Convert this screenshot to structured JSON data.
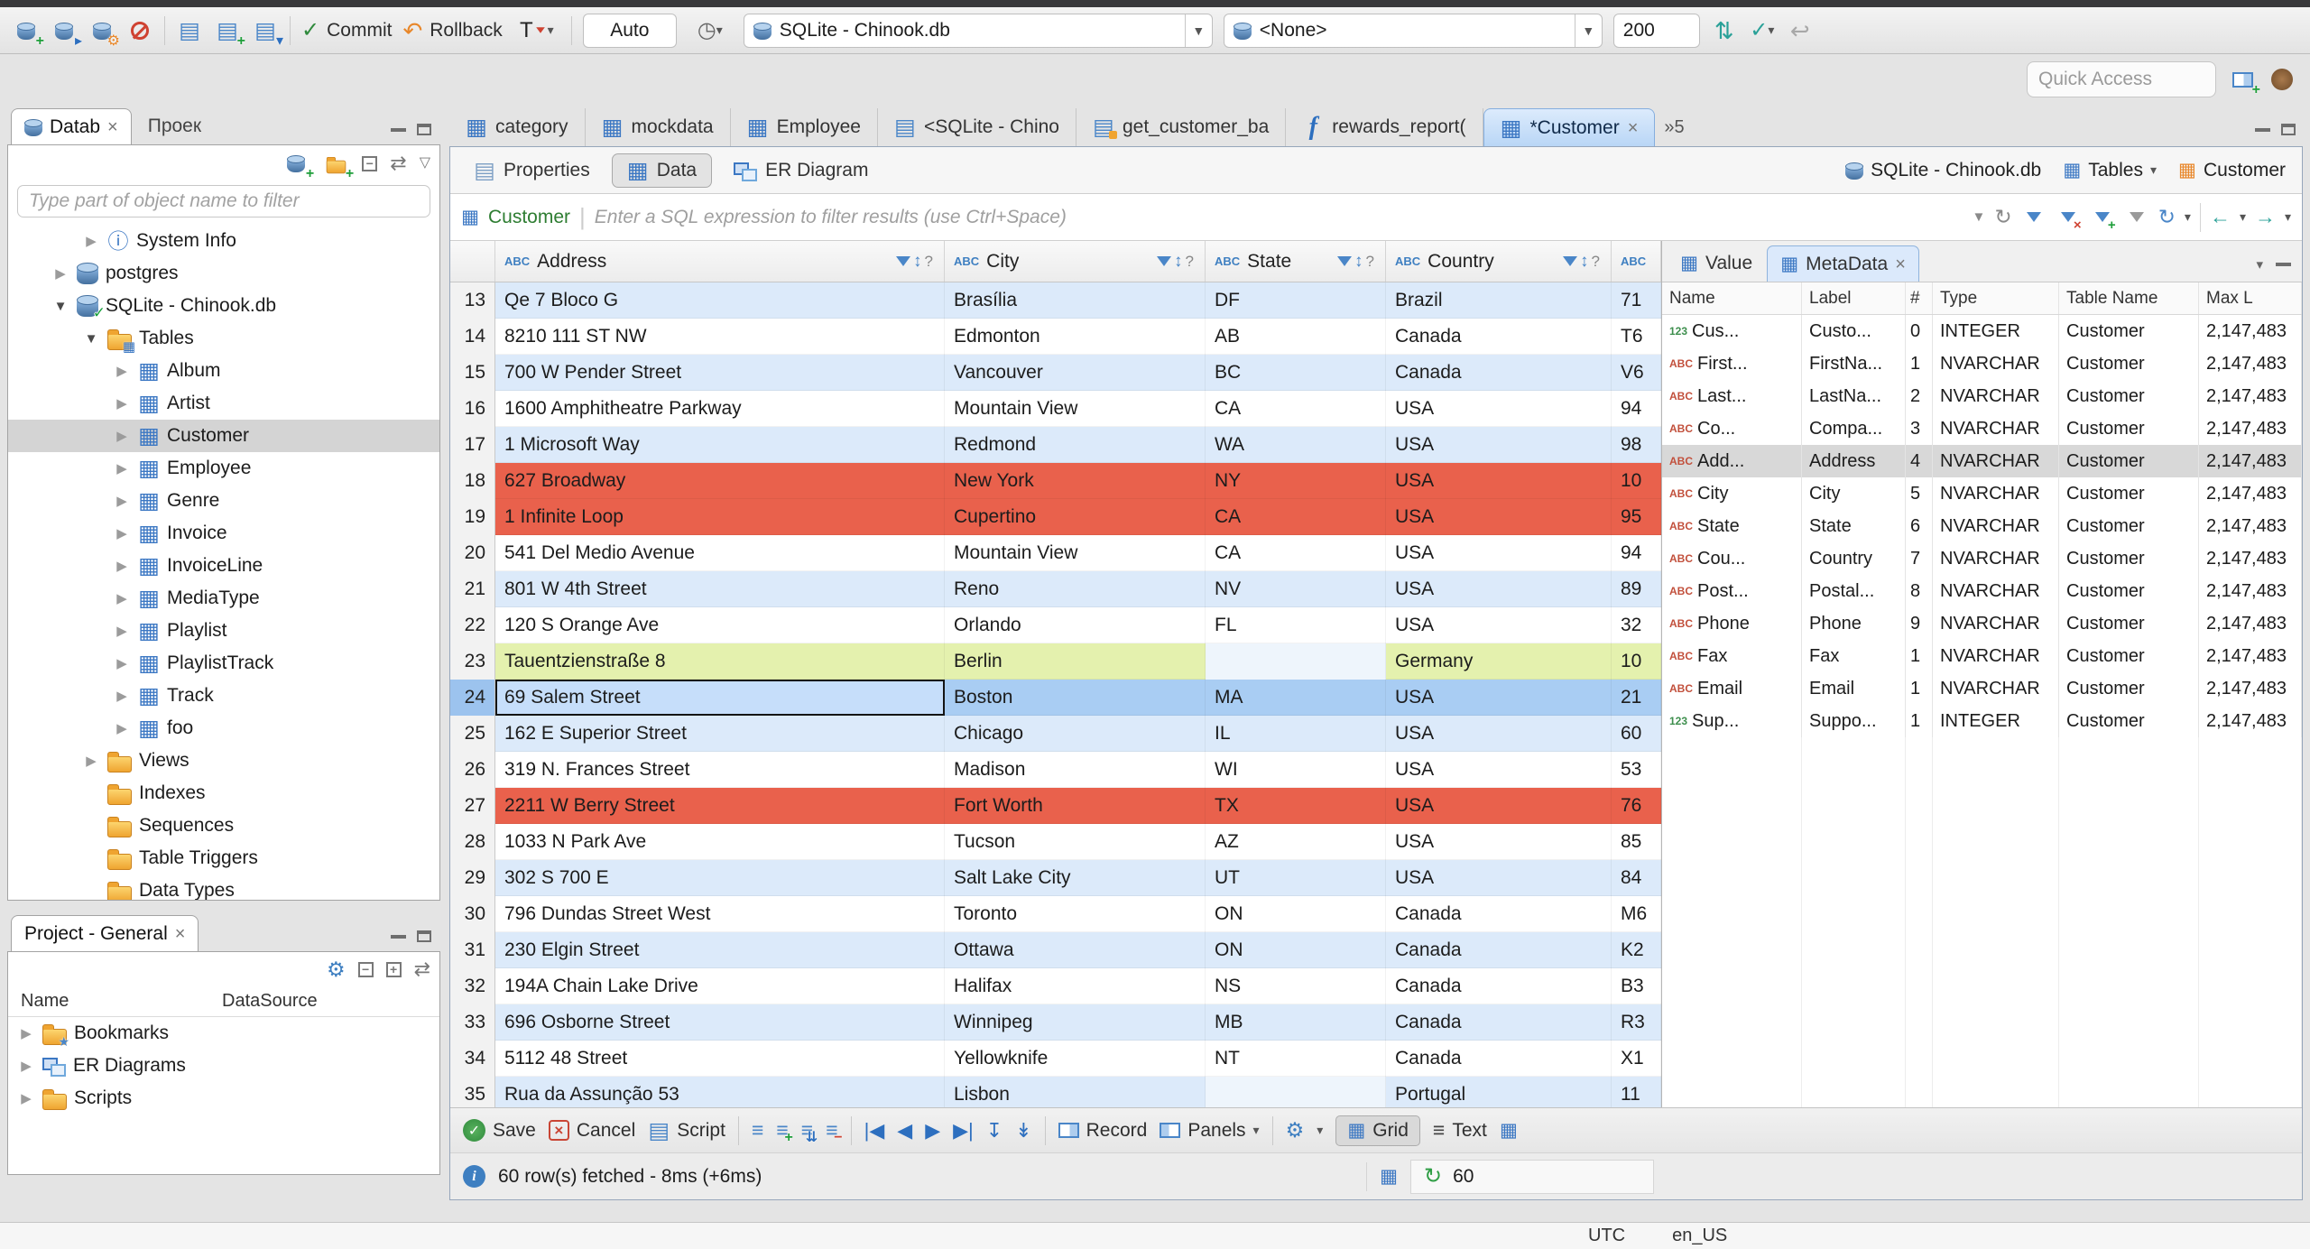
{
  "top_toolbar": {
    "commit": "Commit",
    "rollback": "Rollback",
    "auto": "Auto",
    "connection": "SQLite - Chinook.db",
    "schema": "<None>",
    "fetch_size": "200",
    "quick_access_placeholder": "Quick Access"
  },
  "navigator": {
    "tab_database": "Datab",
    "tab_projects": "Проек",
    "filter_placeholder": "Type part of object name to filter",
    "tree": [
      {
        "label": "System Info",
        "icon": "icon-info",
        "arrow": "arrow-right",
        "indent": 2,
        "row_class": ""
      },
      {
        "label": "postgres",
        "icon": "icon-db",
        "arrow": "arrow-right",
        "indent": 1,
        "row_class": ""
      },
      {
        "label": "SQLite - Chinook.db",
        "icon": "icon-db-on",
        "arrow": "arrow-down",
        "indent": 1,
        "row_class": ""
      },
      {
        "label": "Tables",
        "icon": "icon-folder icon-folder-table",
        "arrow": "arrow-down",
        "indent": 2,
        "row_class": ""
      },
      {
        "label": "Album",
        "icon": "icon-table",
        "arrow": "arrow-right",
        "indent": 3,
        "row_class": ""
      },
      {
        "label": "Artist",
        "icon": "icon-table",
        "arrow": "arrow-right",
        "indent": 3,
        "row_class": ""
      },
      {
        "label": "Customer",
        "icon": "icon-table",
        "arrow": "arrow-right",
        "indent": 3,
        "row_class": "selected"
      },
      {
        "label": "Employee",
        "icon": "icon-table",
        "arrow": "arrow-right",
        "indent": 3,
        "row_class": ""
      },
      {
        "label": "Genre",
        "icon": "icon-table",
        "arrow": "arrow-right",
        "indent": 3,
        "row_class": ""
      },
      {
        "label": "Invoice",
        "icon": "icon-table",
        "arrow": "arrow-right",
        "indent": 3,
        "row_class": ""
      },
      {
        "label": "InvoiceLine",
        "icon": "icon-table",
        "arrow": "arrow-right",
        "indent": 3,
        "row_class": ""
      },
      {
        "label": "MediaType",
        "icon": "icon-table",
        "arrow": "arrow-right",
        "indent": 3,
        "row_class": ""
      },
      {
        "label": "Playlist",
        "icon": "icon-table",
        "arrow": "arrow-right",
        "indent": 3,
        "row_class": ""
      },
      {
        "label": "PlaylistTrack",
        "icon": "icon-table",
        "arrow": "arrow-right",
        "indent": 3,
        "row_class": ""
      },
      {
        "label": "Track",
        "icon": "icon-table",
        "arrow": "arrow-right",
        "indent": 3,
        "row_class": ""
      },
      {
        "label": "foo",
        "icon": "icon-table",
        "arrow": "arrow-right",
        "indent": 3,
        "row_class": ""
      },
      {
        "label": "Views",
        "icon": "icon-folder",
        "arrow": "arrow-right",
        "indent": 2,
        "row_class": ""
      },
      {
        "label": "Indexes",
        "icon": "icon-folder",
        "arrow": "arrow-none",
        "indent": 2,
        "row_class": ""
      },
      {
        "label": "Sequences",
        "icon": "icon-folder",
        "arrow": "arrow-none",
        "indent": 2,
        "row_class": ""
      },
      {
        "label": "Table Triggers",
        "icon": "icon-folder",
        "arrow": "arrow-none",
        "indent": 2,
        "row_class": ""
      },
      {
        "label": "Data Types",
        "icon": "icon-folder",
        "arrow": "arrow-none",
        "indent": 2,
        "row_class": ""
      }
    ]
  },
  "project_panel": {
    "title": "Project - General",
    "col_name": "Name",
    "col_datasource": "DataSource",
    "tree": [
      {
        "label": "Bookmarks",
        "icon": "icon-folder icon-folder-star",
        "arrow": "arrow-right"
      },
      {
        "label": "ER Diagrams",
        "icon": "icon-er",
        "arrow": "arrow-right"
      },
      {
        "label": "Scripts",
        "icon": "icon-folder",
        "arrow": "arrow-right"
      }
    ]
  },
  "editor": {
    "tabs": [
      {
        "label": "category",
        "icon": "icon-table",
        "tab_class": "",
        "close_class": "hide"
      },
      {
        "label": "mockdata",
        "icon": "icon-table",
        "tab_class": "",
        "close_class": "hide"
      },
      {
        "label": "Employee",
        "icon": "icon-table",
        "tab_class": "",
        "close_class": "hide"
      },
      {
        "label": "<SQLite - Chino",
        "icon": "icon-sql",
        "tab_class": "",
        "close_class": "hide"
      },
      {
        "label": "get_customer_ba",
        "icon": "icon-sql icon-sql-edit",
        "tab_class": "",
        "close_class": "hide"
      },
      {
        "label": "rewards_report(",
        "icon": "icon-func",
        "tab_class": "",
        "close_class": "hide"
      },
      {
        "label": "*Customer",
        "icon": "icon-table",
        "tab_class": "tab-active",
        "close_class": "show"
      },
      {
        "label": "»5",
        "icon": "icon-none",
        "tab_class": "tab-overflow",
        "close_class": "hide"
      }
    ],
    "result_tabs": {
      "properties": "Properties",
      "data": "Data",
      "er_diagram": "ER Diagram"
    },
    "context": {
      "connection": "SQLite - Chinook.db",
      "container": "Tables",
      "entity": "Customer"
    },
    "filter": {
      "table": "Customer",
      "placeholder": "Enter a SQL expression to filter results (use Ctrl+Space)"
    }
  },
  "grid": {
    "columns": [
      "Address",
      "City",
      "State",
      "Country"
    ],
    "rows": [
      {
        "num": "13",
        "address": "Qe 7 Bloco G",
        "city": "Brasília",
        "state": "DF",
        "country": "Brazil",
        "postal": "71",
        "row_class": "r-alt",
        "addr_class": "",
        "state_class": ""
      },
      {
        "num": "14",
        "address": "8210 111 ST NW",
        "city": "Edmonton",
        "state": "AB",
        "country": "Canada",
        "postal": "T6",
        "row_class": "",
        "addr_class": "",
        "state_class": ""
      },
      {
        "num": "15",
        "address": "700 W Pender Street",
        "city": "Vancouver",
        "state": "BC",
        "country": "Canada",
        "postal": "V6",
        "row_class": "r-alt",
        "addr_class": "",
        "state_class": ""
      },
      {
        "num": "16",
        "address": "1600 Amphitheatre Parkway",
        "city": "Mountain View",
        "state": "CA",
        "country": "USA",
        "postal": "94",
        "row_class": "",
        "addr_class": "",
        "state_class": ""
      },
      {
        "num": "17",
        "address": "1 Microsoft Way",
        "city": "Redmond",
        "state": "WA",
        "country": "USA",
        "postal": "98",
        "row_class": "r-alt",
        "addr_class": "",
        "state_class": ""
      },
      {
        "num": "18",
        "address": "627 Broadway",
        "city": "New York",
        "state": "NY",
        "country": "USA",
        "postal": "10",
        "row_class": "r-red",
        "addr_class": "",
        "state_class": ""
      },
      {
        "num": "19",
        "address": "1 Infinite Loop",
        "city": "Cupertino",
        "state": "CA",
        "country": "USA",
        "postal": "95",
        "row_class": "r-red",
        "addr_class": "",
        "state_class": ""
      },
      {
        "num": "20",
        "address": "541 Del Medio Avenue",
        "city": "Mountain View",
        "state": "CA",
        "country": "USA",
        "postal": "94",
        "row_class": "",
        "addr_class": "",
        "state_class": ""
      },
      {
        "num": "21",
        "address": "801 W 4th Street",
        "city": "Reno",
        "state": "NV",
        "country": "USA",
        "postal": "89",
        "row_class": "r-alt",
        "addr_class": "",
        "state_class": ""
      },
      {
        "num": "22",
        "address": "120 S Orange Ave",
        "city": "Orlando",
        "state": "FL",
        "country": "USA",
        "postal": "32",
        "row_class": "",
        "addr_class": "",
        "state_class": ""
      },
      {
        "num": "23",
        "address": "Tauentzienstraße 8",
        "city": "Berlin",
        "state": "",
        "country": "Germany",
        "postal": "10",
        "row_class": "r-green",
        "addr_class": "",
        "state_class": "null-cell"
      },
      {
        "num": "24",
        "address": "69 Salem Street",
        "city": "Boston",
        "state": "MA",
        "country": "USA",
        "postal": "21",
        "row_class": "r-sel",
        "addr_class": "focus-cell",
        "state_class": ""
      },
      {
        "num": "25",
        "address": "162 E Superior Street",
        "city": "Chicago",
        "state": "IL",
        "country": "USA",
        "postal": "60",
        "row_class": "r-alt",
        "addr_class": "",
        "state_class": ""
      },
      {
        "num": "26",
        "address": "319 N. Frances Street",
        "city": "Madison",
        "state": "WI",
        "country": "USA",
        "postal": "53",
        "row_class": "",
        "addr_class": "",
        "state_class": ""
      },
      {
        "num": "27",
        "address": "2211 W Berry Street",
        "city": "Fort Worth",
        "state": "TX",
        "country": "USA",
        "postal": "76",
        "row_class": "r-red",
        "addr_class": "",
        "state_class": ""
      },
      {
        "num": "28",
        "address": "1033 N Park Ave",
        "city": "Tucson",
        "state": "AZ",
        "country": "USA",
        "postal": "85",
        "row_class": "",
        "addr_class": "",
        "state_class": ""
      },
      {
        "num": "29",
        "address": "302 S 700 E",
        "city": "Salt Lake City",
        "state": "UT",
        "country": "USA",
        "postal": "84",
        "row_class": "r-alt",
        "addr_class": "",
        "state_class": ""
      },
      {
        "num": "30",
        "address": "796 Dundas Street West",
        "city": "Toronto",
        "state": "ON",
        "country": "Canada",
        "postal": "M6",
        "row_class": "",
        "addr_class": "",
        "state_class": ""
      },
      {
        "num": "31",
        "address": "230 Elgin Street",
        "city": "Ottawa",
        "state": "ON",
        "country": "Canada",
        "postal": "K2",
        "row_class": "r-alt",
        "addr_class": "",
        "state_class": ""
      },
      {
        "num": "32",
        "address": "194A Chain Lake Drive",
        "city": "Halifax",
        "state": "NS",
        "country": "Canada",
        "postal": "B3",
        "row_class": "",
        "addr_class": "",
        "state_class": ""
      },
      {
        "num": "33",
        "address": "696 Osborne Street",
        "city": "Winnipeg",
        "state": "MB",
        "country": "Canada",
        "postal": "R3",
        "row_class": "r-alt",
        "addr_class": "",
        "state_class": ""
      },
      {
        "num": "34",
        "address": "5112 48 Street",
        "city": "Yellowknife",
        "state": "NT",
        "country": "Canada",
        "postal": "X1",
        "row_class": "",
        "addr_class": "",
        "state_class": ""
      },
      {
        "num": "35",
        "address": "Rua da Assunção 53",
        "city": "Lisbon",
        "state": "",
        "country": "Portugal",
        "postal": "11",
        "row_class": "r-alt",
        "addr_class": "",
        "state_class": "null-cell"
      }
    ]
  },
  "metadata": {
    "tab_value": "Value",
    "tab_metadata": "MetaData",
    "columns": [
      "Name",
      "Label",
      "#",
      "Type",
      "Table Name",
      "Max L"
    ],
    "rows": [
      {
        "dt": "dt-num",
        "name": "Cus...",
        "label": "Custo...",
        "num": "0",
        "type": "INTEGER",
        "table": "Customer",
        "max": "2,147,483",
        "row_class": ""
      },
      {
        "dt": "dt-text",
        "name": "First...",
        "label": "FirstNa...",
        "num": "1",
        "type": "NVARCHAR",
        "table": "Customer",
        "max": "2,147,483",
        "row_class": ""
      },
      {
        "dt": "dt-text",
        "name": "Last...",
        "label": "LastNa...",
        "num": "2",
        "type": "NVARCHAR",
        "table": "Customer",
        "max": "2,147,483",
        "row_class": ""
      },
      {
        "dt": "dt-text",
        "name": "Co...",
        "label": "Compa...",
        "num": "3",
        "type": "NVARCHAR",
        "table": "Customer",
        "max": "2,147,483",
        "row_class": ""
      },
      {
        "dt": "dt-text",
        "name": "Add...",
        "label": "Address",
        "num": "4",
        "type": "NVARCHAR",
        "table": "Customer",
        "max": "2,147,483",
        "row_class": "m-sel"
      },
      {
        "dt": "dt-text",
        "name": "City",
        "label": "City",
        "num": "5",
        "type": "NVARCHAR",
        "table": "Customer",
        "max": "2,147,483",
        "row_class": ""
      },
      {
        "dt": "dt-text",
        "name": "State",
        "label": "State",
        "num": "6",
        "type": "NVARCHAR",
        "table": "Customer",
        "max": "2,147,483",
        "row_class": ""
      },
      {
        "dt": "dt-text",
        "name": "Cou...",
        "label": "Country",
        "num": "7",
        "type": "NVARCHAR",
        "table": "Customer",
        "max": "2,147,483",
        "row_class": ""
      },
      {
        "dt": "dt-text",
        "name": "Post...",
        "label": "Postal...",
        "num": "8",
        "type": "NVARCHAR",
        "table": "Customer",
        "max": "2,147,483",
        "row_class": ""
      },
      {
        "dt": "dt-text",
        "name": "Phone",
        "label": "Phone",
        "num": "9",
        "type": "NVARCHAR",
        "table": "Customer",
        "max": "2,147,483",
        "row_class": ""
      },
      {
        "dt": "dt-text",
        "name": "Fax",
        "label": "Fax",
        "num": "1",
        "type": "NVARCHAR",
        "table": "Customer",
        "max": "2,147,483",
        "row_class": ""
      },
      {
        "dt": "dt-text",
        "name": "Email",
        "label": "Email",
        "num": "1",
        "type": "NVARCHAR",
        "table": "Customer",
        "max": "2,147,483",
        "row_class": ""
      },
      {
        "dt": "dt-num",
        "name": "Sup...",
        "label": "Suppo...",
        "num": "1",
        "type": "INTEGER",
        "table": "Customer",
        "max": "2,147,483",
        "row_class": ""
      }
    ]
  },
  "bottom_toolbar": {
    "save": "Save",
    "cancel": "Cancel",
    "script": "Script",
    "record": "Record",
    "panels": "Panels",
    "grid": "Grid",
    "text": "Text"
  },
  "status": {
    "message": "60 row(s) fetched - 8ms (+6ms)",
    "row_count": "60"
  }
}
